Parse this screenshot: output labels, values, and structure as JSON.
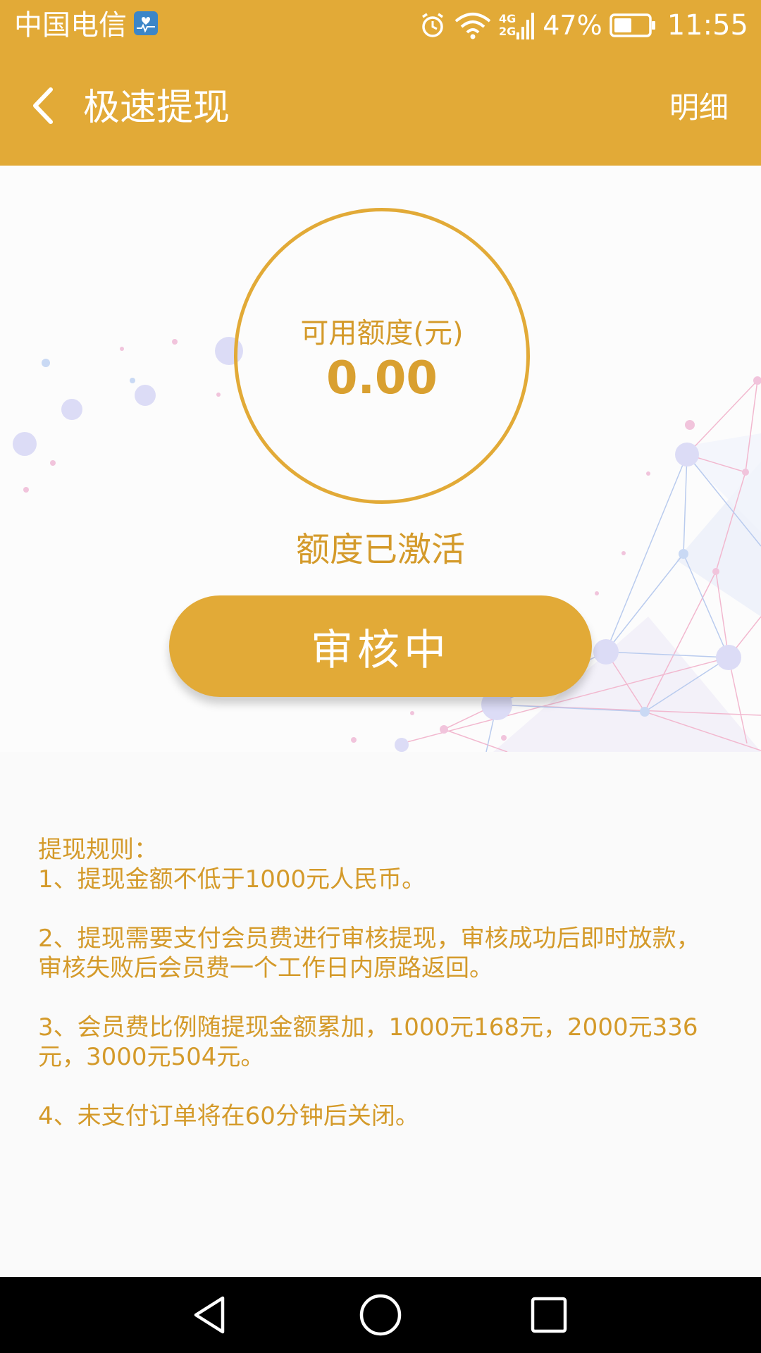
{
  "status_bar": {
    "carrier": "中国电信",
    "network_top": "4G",
    "network_bottom": "2G",
    "battery_percent": "47%",
    "time": "11:55",
    "icons": [
      "health-app-icon",
      "alarm-icon",
      "wifi-icon",
      "signal-icon",
      "battery-icon"
    ]
  },
  "app_bar": {
    "title": "极速提现",
    "right_link": "明细",
    "back_icon": "chevron-left-icon"
  },
  "balance": {
    "label": "可用额度(元)",
    "amount": "0.00",
    "status": "额度已激活"
  },
  "action": {
    "button_label": "审核中"
  },
  "rules": {
    "title": "提现规则：",
    "items": [
      "1、提现金额不低于1000元人民币。",
      "2、提现需要支付会员费进行审核提现，审核成功后即时放款，审核失败后会员费一个工作日内原路返回。",
      "3、会员费比例随提现金额累加，1000元168元，2000元336元，3000元504元。",
      "4、未支付订单将在60分钟后关闭。"
    ]
  },
  "nav_bar": {
    "icons": [
      "back-triangle-icon",
      "home-circle-icon",
      "recents-square-icon"
    ]
  },
  "colors": {
    "accent": "#e2aa37",
    "accent_text": "#d49a2a",
    "background": "#fafafa",
    "nav_bar": "#000000"
  }
}
